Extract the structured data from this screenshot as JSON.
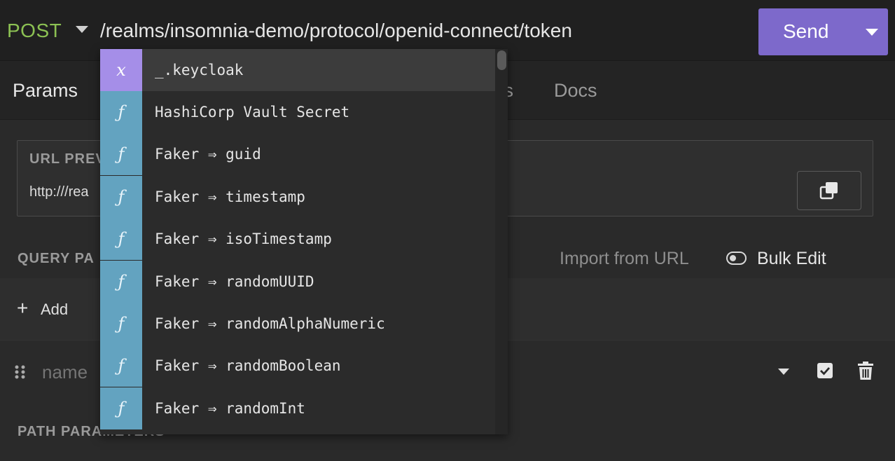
{
  "request": {
    "method": "POST",
    "url": "/realms/insomnia-demo/protocol/openid-connect/token",
    "send_label": "Send"
  },
  "tabs": [
    {
      "label": "Params"
    },
    {
      "label": "ts"
    },
    {
      "label": "Docs"
    }
  ],
  "url_preview": {
    "title": "URL PREV",
    "value": "http:///rea"
  },
  "query_params": {
    "title": "QUERY PA",
    "import_label": "Import from URL",
    "bulk_edit_label": "Bulk Edit",
    "add_label": "Add",
    "name_placeholder": "name"
  },
  "path_params": {
    "title": "PATH PARAMETERS"
  },
  "autocomplete": {
    "items": [
      {
        "kind": "x",
        "label": "_.keycloak"
      },
      {
        "kind": "ƒ",
        "label": "HashiCorp Vault Secret"
      },
      {
        "kind": "ƒ",
        "label": "Faker ⇒ guid"
      },
      {
        "kind": "ƒ",
        "label": "Faker ⇒ timestamp"
      },
      {
        "kind": "ƒ",
        "label": "Faker ⇒ isoTimestamp"
      },
      {
        "kind": "ƒ",
        "label": "Faker ⇒ randomUUID"
      },
      {
        "kind": "ƒ",
        "label": "Faker ⇒ randomAlphaNumeric"
      },
      {
        "kind": "ƒ",
        "label": "Faker ⇒ randomBoolean"
      },
      {
        "kind": "ƒ",
        "label": "Faker ⇒ randomInt"
      }
    ]
  },
  "colors": {
    "method": "#8cc153",
    "send_button": "#7d69cb",
    "variable_badge": "#a58ee8",
    "function_badge": "#63a3c0"
  },
  "icons": {
    "method_caret": "chevron-down-icon",
    "send_caret": "chevron-down-icon",
    "copy": "copy-icon",
    "toggle": "toggle-icon",
    "add": "plus-icon",
    "drag": "drag-handle-icon",
    "checkbox": "checkbox-checked-icon",
    "trash": "trash-icon"
  }
}
